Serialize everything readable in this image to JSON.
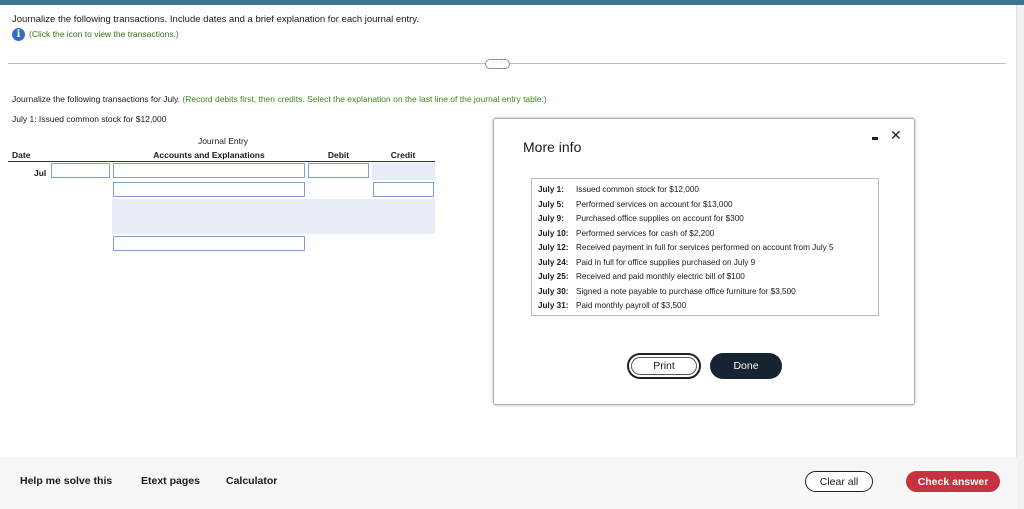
{
  "header": {
    "instruction": "Journalize the following transactions. Include dates and a brief explanation for each journal entry.",
    "info_link": "(Click the icon to view the transactions.)",
    "expand_label": "· · ·"
  },
  "question": {
    "lead": "Journalize the following transactions for July. ",
    "note": "(Record debits first, then credits. Select the explanation on the last line of the journal entry table.)",
    "current": "July 1: Issued common stock for $12,000"
  },
  "journal": {
    "title": "Journal Entry",
    "col_date": "Date",
    "col_accounts": "Accounts and Explanations",
    "col_debit": "Debit",
    "col_credit": "Credit",
    "month": "Jul"
  },
  "modal": {
    "title": "More info",
    "minimize_icon": "minus-icon",
    "close_icon": "close-icon",
    "items": [
      {
        "date": "July 1:",
        "text": "Issued common stock for $12,000"
      },
      {
        "date": "July 5:",
        "text": "Performed services on account for $13,000"
      },
      {
        "date": "July 9:",
        "text": "Purchased office supplies on account for $300"
      },
      {
        "date": "July 10:",
        "text": "Performed services for cash of $2,200"
      },
      {
        "date": "July 12:",
        "text": "Received payment in full for services performed on account from July 5"
      },
      {
        "date": "July 24:",
        "text": "Paid in full for office supplies purchased on July 9"
      },
      {
        "date": "July 25:",
        "text": "Received and paid monthly electric bill of $100"
      },
      {
        "date": "July 30:",
        "text": "Signed a note payable to purchase office furniture for $3,500"
      },
      {
        "date": "July 31:",
        "text": "Paid monthly payroll of $3,500"
      }
    ],
    "print_label": "Print",
    "done_label": "Done"
  },
  "footer": {
    "help": "Help me solve this",
    "etext": "Etext pages",
    "calculator": "Calculator",
    "clear": "Clear all",
    "check": "Check answer"
  },
  "colors": {
    "accent_bar": "#3d7590",
    "link_green": "#3a8a1a",
    "check_red": "#c8313f",
    "done_dark": "#172330"
  }
}
